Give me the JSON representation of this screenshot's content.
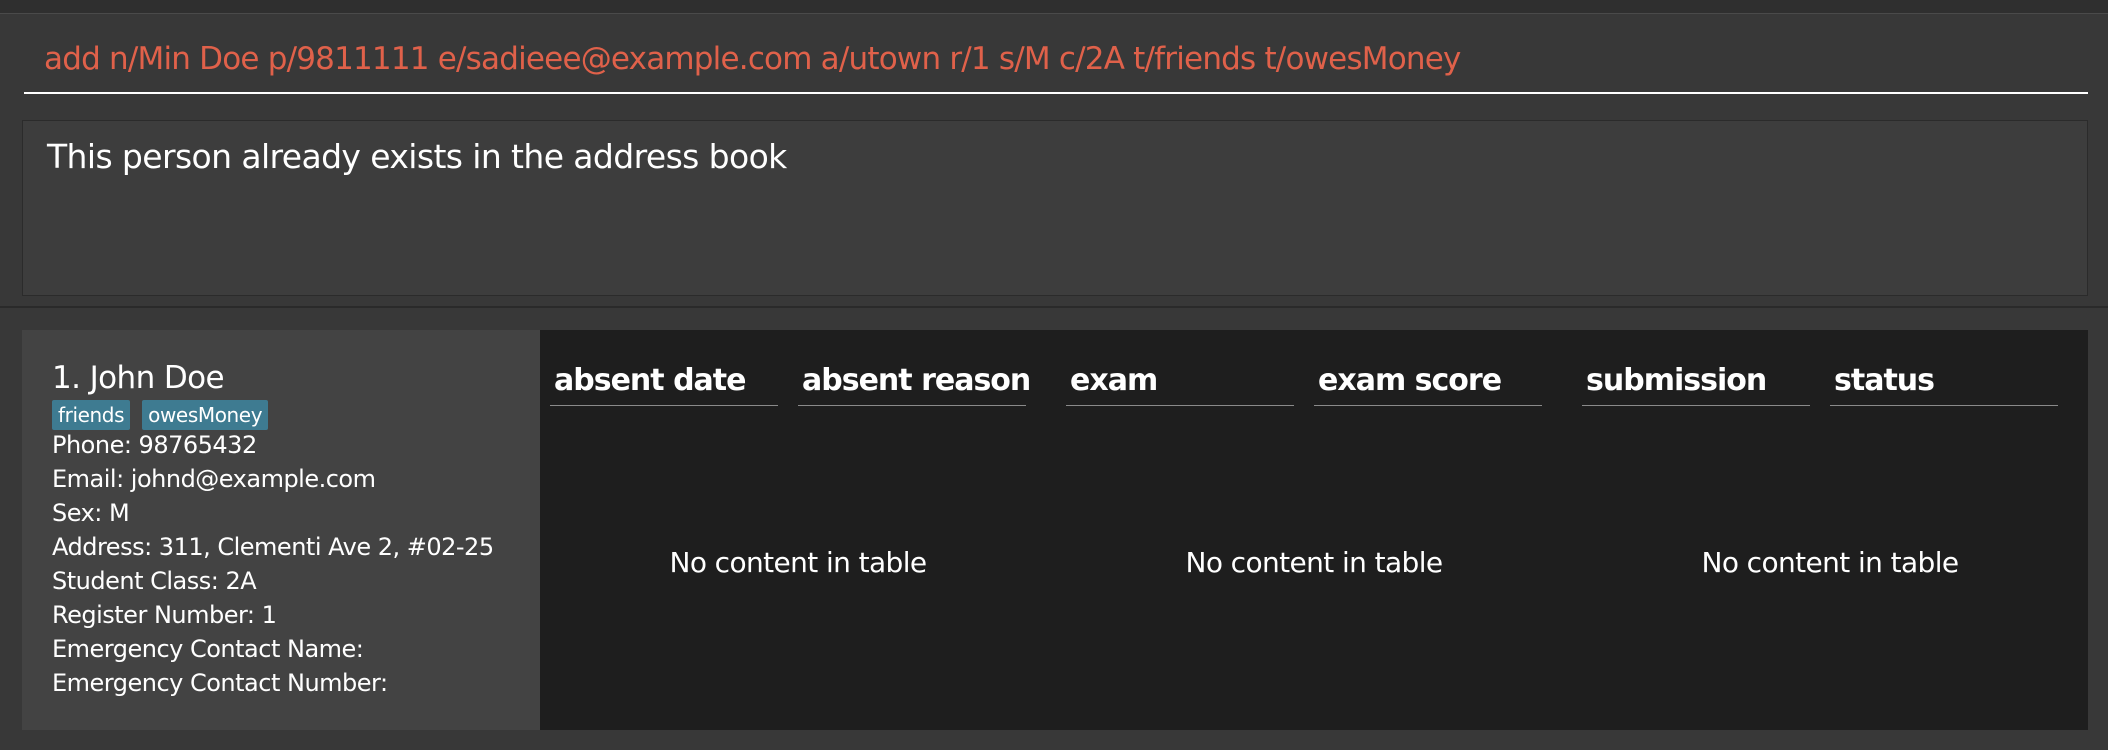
{
  "command": {
    "value": "add n/Min Doe p/9811111 e/sadieee@example.com a/utown r/1 s/M c/2A t/friends t/owesMoney",
    "color": "#e0614a"
  },
  "result": {
    "text": "This person already exists in the address book"
  },
  "person": {
    "name": "1. John Doe",
    "tags": [
      "friends",
      "owesMoney"
    ],
    "fields": [
      "Phone: 98765432",
      "Email: johnd@example.com",
      "Sex: M",
      "Address: 311, Clementi Ave 2, #02-25",
      "Student Class: 2A",
      "Register Number: 1",
      "Emergency Contact Name:",
      "Emergency Contact Number:"
    ]
  },
  "tables": [
    {
      "columns": [
        "absent date",
        "absent reason"
      ],
      "empty_message": "No content in table"
    },
    {
      "columns": [
        "exam",
        "exam score"
      ],
      "empty_message": "No content in table"
    },
    {
      "columns": [
        "submission",
        "status"
      ],
      "empty_message": "No content in table"
    }
  ],
  "colors": {
    "tag": "#3e7b91",
    "background": "#383838",
    "table_background": "#1e1e1e"
  }
}
